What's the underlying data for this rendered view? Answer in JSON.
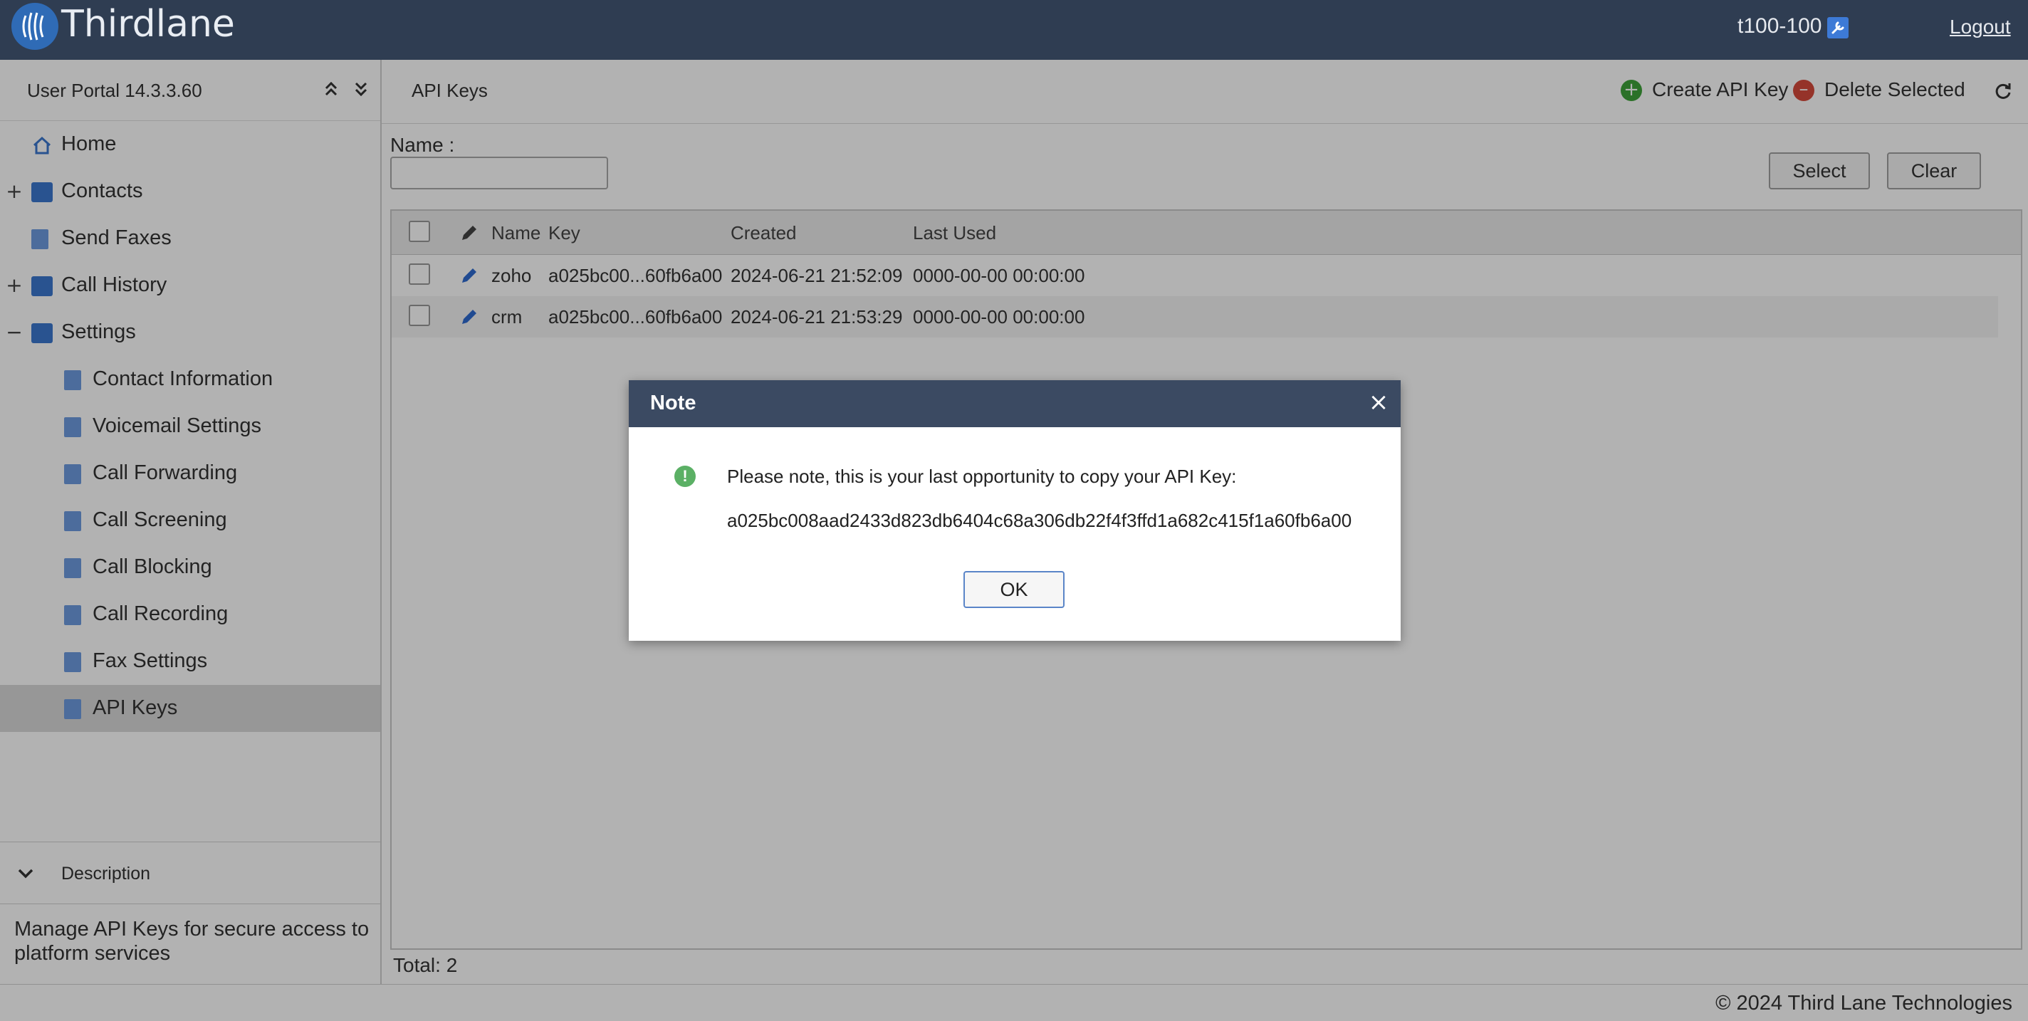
{
  "header": {
    "brand": "Thirdlane",
    "user": "t100-100",
    "logout_label": "Logout"
  },
  "sidebar": {
    "portal_version": "User Portal 14.3.3.60",
    "items": [
      {
        "label": "Home",
        "icon": "home-icon",
        "level": 0
      },
      {
        "label": "Contacts",
        "icon": "folder-icon",
        "level": 0,
        "expander": "+"
      },
      {
        "label": "Send Faxes",
        "icon": "document-icon",
        "level": 0
      },
      {
        "label": "Call History",
        "icon": "folder-icon",
        "level": 0,
        "expander": "+"
      },
      {
        "label": "Settings",
        "icon": "folder-icon",
        "level": 0,
        "expander": "−"
      },
      {
        "label": "Contact Information",
        "icon": "document-icon",
        "level": 1
      },
      {
        "label": "Voicemail Settings",
        "icon": "document-icon",
        "level": 1
      },
      {
        "label": "Call Forwarding",
        "icon": "document-icon",
        "level": 1
      },
      {
        "label": "Call Screening",
        "icon": "document-icon",
        "level": 1
      },
      {
        "label": "Call Blocking",
        "icon": "document-icon",
        "level": 1
      },
      {
        "label": "Call Recording",
        "icon": "document-icon",
        "level": 1
      },
      {
        "label": "Fax Settings",
        "icon": "document-icon",
        "level": 1
      },
      {
        "label": "API Keys",
        "icon": "document-icon",
        "level": 1,
        "selected": true
      }
    ],
    "description_label": "Description",
    "description_text": "Manage API Keys for secure access to platform services"
  },
  "main": {
    "title": "API Keys",
    "create_label": "Create API Key",
    "delete_label": "Delete Selected",
    "filter": {
      "name_label": "Name :",
      "name_value": "",
      "select_label": "Select",
      "clear_label": "Clear"
    },
    "table": {
      "columns": [
        "Name",
        "Key",
        "Created",
        "Last Used"
      ],
      "rows": [
        {
          "name": "zoho",
          "key": "a025bc00...60fb6a00",
          "created": "2024-06-21 21:52:09",
          "last_used": "0000-00-00 00:00:00"
        },
        {
          "name": "crm",
          "key": "a025bc00...60fb6a00",
          "created": "2024-06-21 21:53:29",
          "last_used": "0000-00-00 00:00:00"
        }
      ]
    },
    "total": "Total: 2"
  },
  "footer": {
    "copyright": "© 2024 Third Lane Technologies"
  },
  "dialog": {
    "title": "Note",
    "close_glyph": "×",
    "info_glyph": "!",
    "message": "Please note, this is your last opportunity to copy your API Key:",
    "api_key": "a025bc008aad2433d823db6404c68a306db22f4f3ffd1a682c415f1a60fb6a00",
    "ok_label": "OK"
  },
  "colors": {
    "topbar": "#2f3d52",
    "dialog_header": "#3b4a62",
    "create_icon": "#3ea33a",
    "delete_icon": "#d64a3b",
    "info_icon": "#5bb065",
    "folder_icon": "#3b78cf"
  }
}
